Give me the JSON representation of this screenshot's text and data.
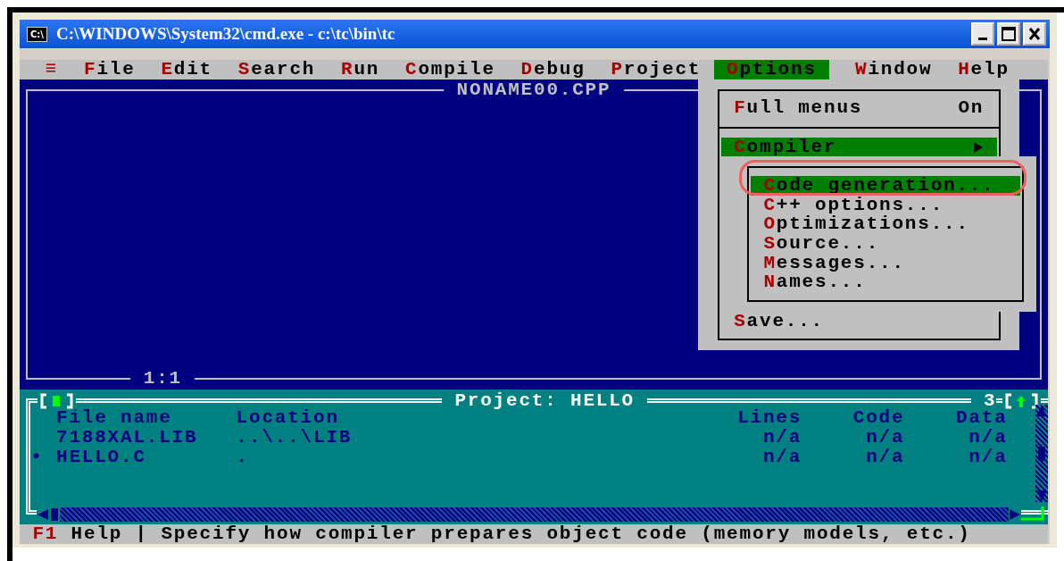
{
  "window": {
    "icon_text": "C:\\",
    "title": "C:\\WINDOWS\\System32\\cmd.exe - c:\\tc\\bin\\tc"
  },
  "menu_bar": {
    "system_menu": "≡",
    "items": [
      {
        "hotkey": "F",
        "rest": "ile",
        "selected": false
      },
      {
        "hotkey": "E",
        "rest": "dit",
        "selected": false
      },
      {
        "hotkey": "S",
        "rest": "earch",
        "selected": false
      },
      {
        "hotkey": "R",
        "rest": "un",
        "selected": false
      },
      {
        "hotkey": "C",
        "rest": "ompile",
        "selected": false
      },
      {
        "hotkey": "D",
        "rest": "ebug",
        "selected": false
      },
      {
        "hotkey": "P",
        "rest": "roject",
        "selected": false
      },
      {
        "hotkey": "O",
        "rest": "ptions",
        "selected": true
      },
      {
        "hotkey": "W",
        "rest": "indow",
        "selected": false
      },
      {
        "hotkey": "H",
        "rest": "elp",
        "selected": false
      }
    ]
  },
  "editor": {
    "title": "NONAME00.CPP",
    "cursor_position": "1:1"
  },
  "options_menu": {
    "items": [
      {
        "kind": "toggle",
        "hotkey": "F",
        "rest": "ull menus",
        "value": "On",
        "selected": false
      },
      {
        "kind": "divider"
      },
      {
        "kind": "submenu",
        "hotkey": "C",
        "rest": "ompiler",
        "selected": true
      },
      {
        "kind": "command",
        "hotkey": "S",
        "rest": "ave...",
        "selected": false
      }
    ]
  },
  "compiler_submenu": {
    "items": [
      {
        "hotkey": "C",
        "rest": "ode generation...",
        "selected": true
      },
      {
        "hotkey": "C",
        "rest": "++ options...",
        "selected": false
      },
      {
        "hotkey": "O",
        "rest": "ptimizations...",
        "selected": false
      },
      {
        "hotkey": "S",
        "rest": "ource...",
        "selected": false
      },
      {
        "hotkey": "M",
        "rest": "essages...",
        "selected": false
      },
      {
        "hotkey": "N",
        "rest": "ames...",
        "selected": false
      }
    ]
  },
  "project": {
    "title": "Project: HELLO",
    "window_number": "3",
    "columns": [
      "File name",
      "Location",
      "Lines",
      "Code",
      "Data"
    ],
    "rows": [
      {
        "marker": "",
        "cells": [
          "7188XAL.LIB",
          "..\\..\\LIB",
          "n/a",
          "n/a",
          "n/a"
        ]
      },
      {
        "marker": "•",
        "cells": [
          "HELLO.C",
          ".",
          "n/a",
          "n/a",
          "n/a"
        ]
      }
    ]
  },
  "status_bar": {
    "key": "F1",
    "key_label": "Help",
    "separator": "|",
    "hint": "Specify how compiler prepares object code (memory models, etc.)"
  }
}
